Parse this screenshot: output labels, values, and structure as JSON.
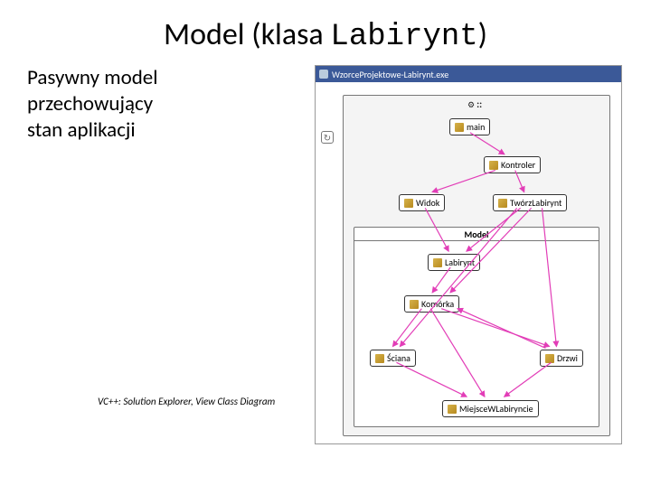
{
  "title": {
    "pre": "Model (klasa ",
    "mono": "Labirynt",
    "post": ")"
  },
  "desc_line1": "Pasywny model",
  "desc_line2": "przechowujący",
  "desc_line3": "stan aplikacji",
  "footnote": "VC++: Solution Explorer, View Class Diagram",
  "diagram": {
    "titlebar": "WzorceProjektowe-Labirynt.exe",
    "ns_label": "::",
    "chips": {
      "main": "main",
      "kontroler": "Kontroler",
      "widok": "Widok",
      "tworz": "TwórzLabirynt",
      "model_header": "Model",
      "labirynt": "Labirynt",
      "komorka": "Komórka",
      "sciana": "Ściana",
      "drzwi": "Drzwi",
      "miejsce": "MiejsceWLabiryncie"
    },
    "refresh_icon": "↻",
    "colors": {
      "arrow": "#e23db7",
      "arrow2": "#e23db7"
    }
  }
}
